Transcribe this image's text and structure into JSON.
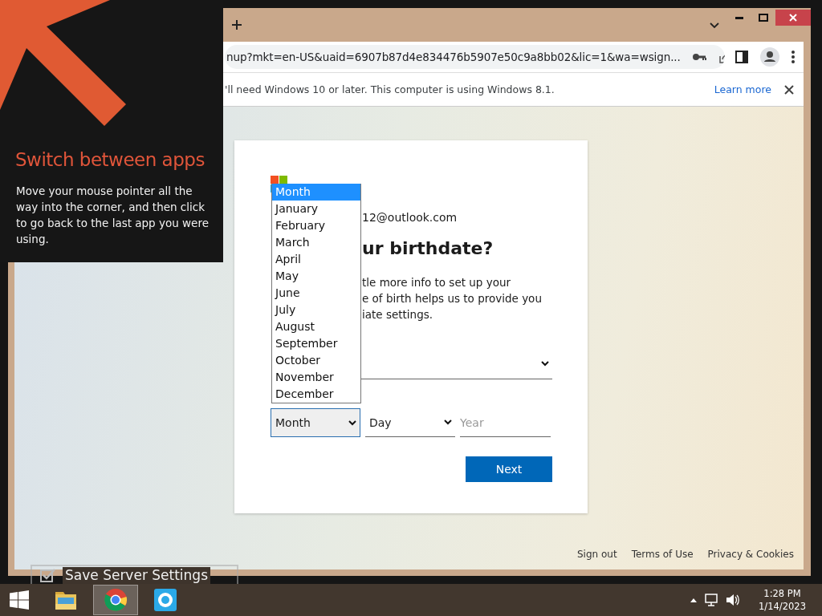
{
  "tip": {
    "title": "Switch between apps",
    "body": "Move your mouse pointer all the way into the corner, and then click to go back to the last app you were using."
  },
  "browser": {
    "url": "nup?mkt=en-US&uaid=6907b87d4e834476b5907e50c9a8bb02&lic=1&wa=wsign...",
    "infobar": {
      "message": "'ll need Windows 10 or later. This computer is using Windows 8.1.",
      "link": "Learn more"
    }
  },
  "signup": {
    "email": "12@outlook.com",
    "heading": "ur birthdate?",
    "description_lines": [
      "tle more info to set up your",
      "e of birth helps us to provide you",
      "iate settings."
    ],
    "month_select": {
      "value": "Month"
    },
    "day_select": {
      "value": "Day"
    },
    "year_field": {
      "placeholder": "Year"
    },
    "next_button": "Next",
    "month_options": [
      {
        "label": "Month",
        "selected": true
      },
      {
        "label": "January",
        "selected": false
      },
      {
        "label": "February",
        "selected": false
      },
      {
        "label": "March",
        "selected": false
      },
      {
        "label": "April",
        "selected": false
      },
      {
        "label": "May",
        "selected": false
      },
      {
        "label": "June",
        "selected": false
      },
      {
        "label": "July",
        "selected": false
      },
      {
        "label": "August",
        "selected": false
      },
      {
        "label": "September",
        "selected": false
      },
      {
        "label": "October",
        "selected": false
      },
      {
        "label": "November",
        "selected": false
      },
      {
        "label": "December",
        "selected": false
      }
    ]
  },
  "footer_links": [
    "Sign out",
    "Terms of Use",
    "Privacy & Cookies"
  ],
  "ghost_caption": "Save Server Settings",
  "taskbar": {
    "apps": [
      {
        "kind": "explorer",
        "active": false
      },
      {
        "kind": "chrome",
        "active": true
      },
      {
        "kind": "skype",
        "active": false
      }
    ],
    "time": "1:28 PM",
    "date": "1/14/2023"
  }
}
